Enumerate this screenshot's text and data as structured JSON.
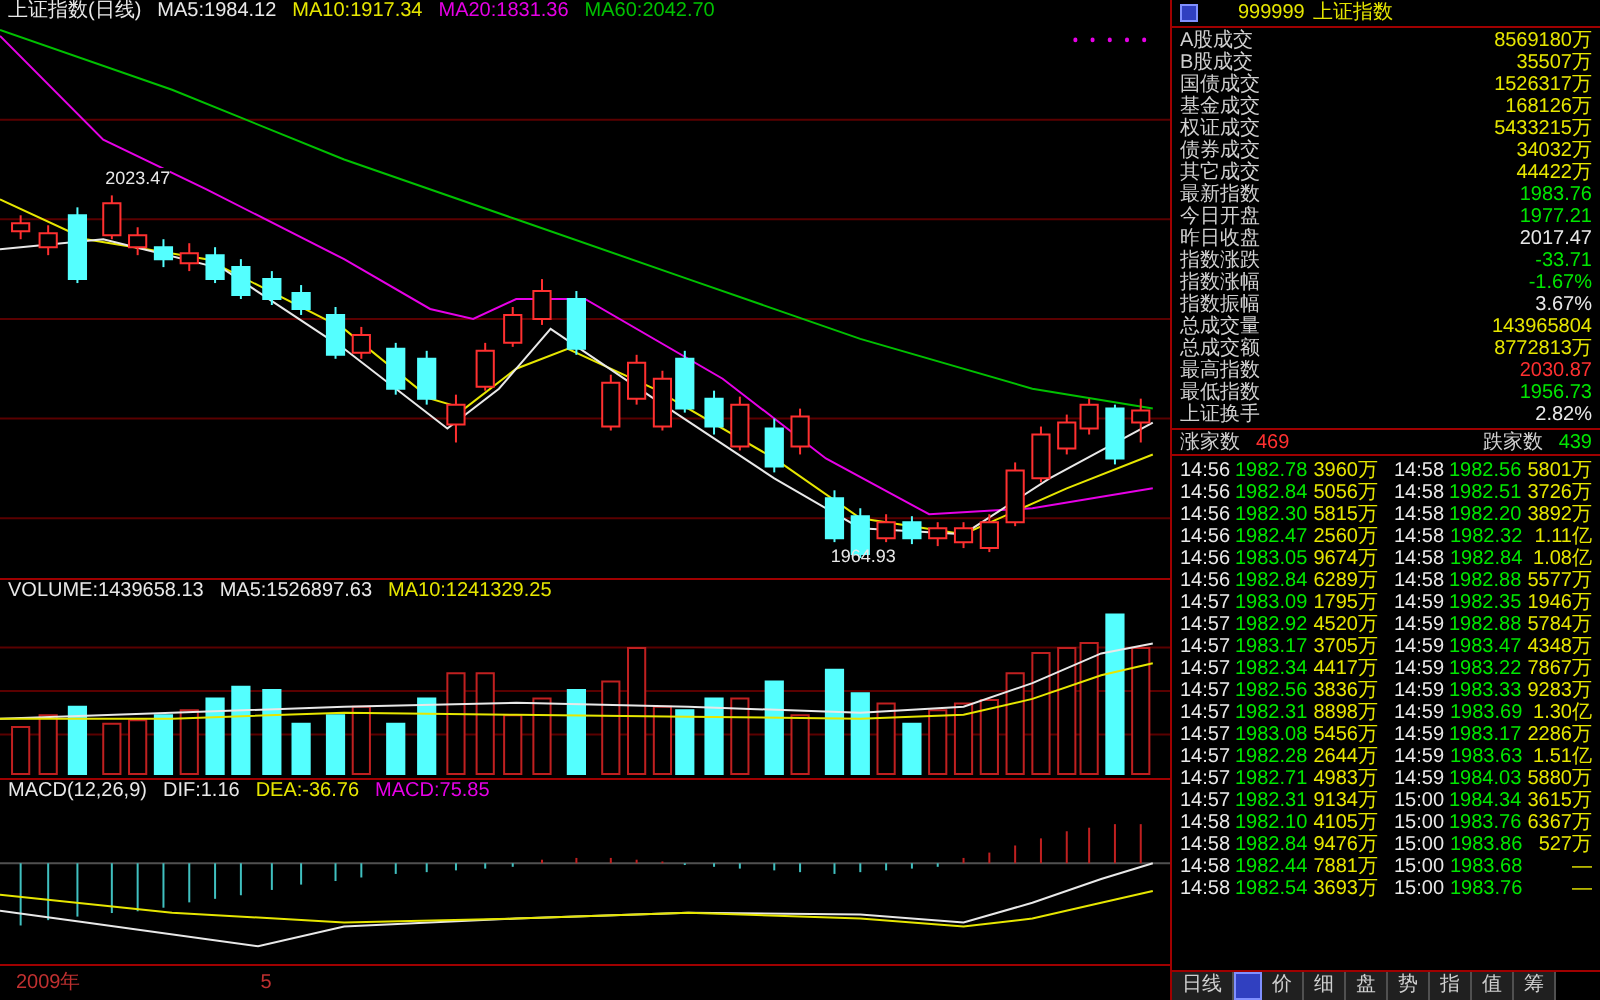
{
  "price_panel": {
    "title": "上证指数(日线)",
    "indicators": [
      {
        "label": "MA5:1984.12",
        "color": "#e8e8e8"
      },
      {
        "label": "MA10:1917.34",
        "color": "#e6e600"
      },
      {
        "label": "MA20:1831.36",
        "color": "#e600e6"
      },
      {
        "label": "MA60:2042.70",
        "color": "#00c000"
      }
    ],
    "annotations": [
      "2023.47",
      "1964.93"
    ]
  },
  "volume_panel": {
    "indicators": [
      {
        "label": "VOLUME:1439658.13",
        "color": "#e8e8e8"
      },
      {
        "label": "MA5:1526897.63",
        "color": "#e8e8e8"
      },
      {
        "label": "MA10:1241329.25",
        "color": "#e6e600"
      }
    ]
  },
  "macd_panel": {
    "indicators": [
      {
        "label": "MACD(12,26,9)",
        "color": "#e8e8e8"
      },
      {
        "label": "DIF:1.16",
        "color": "#e8e8e8"
      },
      {
        "label": "DEA:-36.76",
        "color": "#e6e600"
      },
      {
        "label": "MACD:75.85",
        "color": "#e600e6"
      }
    ]
  },
  "time_axis": [
    "2009年",
    "5"
  ],
  "quote_panel": {
    "code": "999999",
    "name": "上证指数",
    "stats": [
      {
        "label": "A股成交",
        "value": "8569180万",
        "color": "#e6e600"
      },
      {
        "label": "B股成交",
        "value": "35507万",
        "color": "#e6e600"
      },
      {
        "label": "国债成交",
        "value": "1526317万",
        "color": "#e6e600"
      },
      {
        "label": "基金成交",
        "value": "168126万",
        "color": "#e6e600"
      },
      {
        "label": "权证成交",
        "value": "5433215万",
        "color": "#e6e600"
      },
      {
        "label": "债券成交",
        "value": "34032万",
        "color": "#e6e600"
      },
      {
        "label": "其它成交",
        "value": "44422万",
        "color": "#e6e600"
      },
      {
        "label": "最新指数",
        "value": "1983.76",
        "color": "#00e600"
      },
      {
        "label": "今日开盘",
        "value": "1977.21",
        "color": "#00e600"
      },
      {
        "label": "昨日收盘",
        "value": "2017.47",
        "color": "#e8e8e8"
      },
      {
        "label": "指数涨跌",
        "value": "-33.71",
        "color": "#00e600"
      },
      {
        "label": "指数涨幅",
        "value": "-1.67%",
        "color": "#00e600"
      },
      {
        "label": "指数振幅",
        "value": "3.67%",
        "color": "#e8e8e8"
      },
      {
        "label": "总成交量",
        "value": "143965804",
        "color": "#e6e600"
      },
      {
        "label": "总成交额",
        "value": "8772813万",
        "color": "#e6e600"
      },
      {
        "label": "最高指数",
        "value": "2030.87",
        "color": "#ff3030"
      },
      {
        "label": "最低指数",
        "value": "1956.73",
        "color": "#00e600"
      },
      {
        "label": "上证换手",
        "value": "2.82%",
        "color": "#e8e8e8"
      }
    ],
    "breadth": {
      "up_label": "涨家数",
      "up_count": "469",
      "down_label": "跌家数",
      "down_count": "439"
    },
    "ticks": [
      {
        "time": "14:56",
        "price": "1982.78",
        "volume": "3960万"
      },
      {
        "time": "14:56",
        "price": "1982.84",
        "volume": "5056万"
      },
      {
        "time": "14:56",
        "price": "1982.30",
        "volume": "5815万"
      },
      {
        "time": "14:56",
        "price": "1982.47",
        "volume": "2560万"
      },
      {
        "time": "14:56",
        "price": "1983.05",
        "volume": "9674万"
      },
      {
        "time": "14:56",
        "price": "1982.84",
        "volume": "6289万"
      },
      {
        "time": "14:57",
        "price": "1983.09",
        "volume": "1795万"
      },
      {
        "time": "14:57",
        "price": "1982.92",
        "volume": "4520万"
      },
      {
        "time": "14:57",
        "price": "1983.17",
        "volume": "3705万"
      },
      {
        "time": "14:57",
        "price": "1982.34",
        "volume": "4417万"
      },
      {
        "time": "14:57",
        "price": "1982.56",
        "volume": "3836万"
      },
      {
        "time": "14:57",
        "price": "1982.31",
        "volume": "8898万"
      },
      {
        "time": "14:57",
        "price": "1983.08",
        "volume": "5456万"
      },
      {
        "time": "14:57",
        "price": "1982.28",
        "volume": "2644万"
      },
      {
        "time": "14:57",
        "price": "1982.71",
        "volume": "4983万"
      },
      {
        "time": "14:57",
        "price": "1982.31",
        "volume": "9134万"
      },
      {
        "time": "14:58",
        "price": "1982.10",
        "volume": "4105万"
      },
      {
        "time": "14:58",
        "price": "1982.84",
        "volume": "9476万"
      },
      {
        "time": "14:58",
        "price": "1982.44",
        "volume": "7881万"
      },
      {
        "time": "14:58",
        "price": "1982.54",
        "volume": "3693万"
      },
      {
        "time": "14:58",
        "price": "1982.56",
        "volume": "5801万"
      },
      {
        "time": "14:58",
        "price": "1982.51",
        "volume": "3726万"
      },
      {
        "time": "14:58",
        "price": "1982.20",
        "volume": "3892万"
      },
      {
        "time": "14:58",
        "price": "1982.32",
        "volume": "1.11亿"
      },
      {
        "time": "14:58",
        "price": "1982.84",
        "volume": "1.08亿"
      },
      {
        "time": "14:58",
        "price": "1982.88",
        "volume": "5577万"
      },
      {
        "time": "14:59",
        "price": "1982.35",
        "volume": "1946万"
      },
      {
        "time": "14:59",
        "price": "1982.88",
        "volume": "5784万"
      },
      {
        "time": "14:59",
        "price": "1983.47",
        "volume": "4348万"
      },
      {
        "time": "14:59",
        "price": "1983.22",
        "volume": "7867万"
      },
      {
        "time": "14:59",
        "price": "1983.33",
        "volume": "9283万"
      },
      {
        "time": "14:59",
        "price": "1983.69",
        "volume": "1.30亿"
      },
      {
        "time": "14:59",
        "price": "1983.17",
        "volume": "2286万"
      },
      {
        "time": "14:59",
        "price": "1983.63",
        "volume": "1.51亿"
      },
      {
        "time": "14:59",
        "price": "1984.03",
        "volume": "5880万"
      },
      {
        "time": "15:00",
        "price": "1984.34",
        "volume": "3615万"
      },
      {
        "time": "15:00",
        "price": "1983.76",
        "volume": "6367万"
      },
      {
        "time": "15:00",
        "price": "1983.86",
        "volume": "527万"
      },
      {
        "time": "15:00",
        "price": "1983.68",
        "volume": "—"
      },
      {
        "time": "15:00",
        "price": "1983.76",
        "volume": "—"
      }
    ]
  },
  "bottom_tabs": [
    {
      "label": "日线",
      "selected": false
    },
    {
      "label": "价",
      "selected": false
    },
    {
      "label": "细",
      "selected": false
    },
    {
      "label": "盘",
      "selected": false
    },
    {
      "label": "势",
      "selected": false
    },
    {
      "label": "指",
      "selected": false
    },
    {
      "label": "值",
      "selected": false
    },
    {
      "label": "筹",
      "selected": false
    }
  ]
}
